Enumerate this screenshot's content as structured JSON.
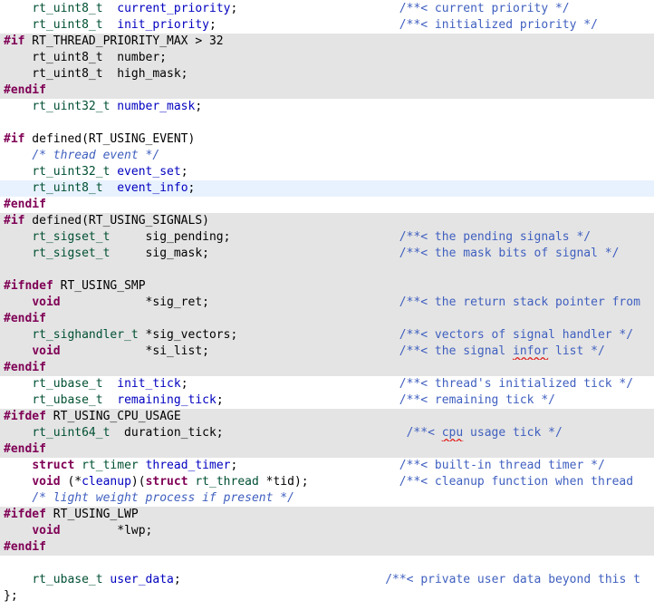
{
  "editor": {
    "language": "c",
    "colors": {
      "background": "#ffffff",
      "inactive_region": "#e4e4e4",
      "current_line": "#e8f2fe",
      "keyword": "#7f0055",
      "type": "#005032",
      "field": "#0000c0",
      "comment": "#3f5fbf",
      "spelling_mark": "#e0201e"
    },
    "lines": [
      {
        "state": "normal",
        "code": [
          [
            "    ",
            "text"
          ],
          [
            "rt_uint8_t",
            "type"
          ],
          [
            "  ",
            "text"
          ],
          [
            "current_priority",
            "id"
          ],
          [
            ";",
            "text"
          ]
        ],
        "comment": [
          [
            "/**< current priority */",
            "doc"
          ]
        ],
        "comment_col": 56
      },
      {
        "state": "normal",
        "code": [
          [
            "    ",
            "text"
          ],
          [
            "rt_uint8_t",
            "type"
          ],
          [
            "  ",
            "text"
          ],
          [
            "init_priority",
            "id"
          ],
          [
            ";",
            "text"
          ]
        ],
        "comment": [
          [
            "/**< initialized priority */",
            "doc"
          ]
        ],
        "comment_col": 56
      },
      {
        "state": "disabled",
        "code": [
          [
            "#if",
            "kw"
          ],
          [
            " RT_THREAD_PRIORITY_MAX > 32",
            "text"
          ]
        ]
      },
      {
        "state": "disabled",
        "code": [
          [
            "    rt_uint8_t  number;",
            "text"
          ]
        ]
      },
      {
        "state": "disabled",
        "code": [
          [
            "    rt_uint8_t  high_mask;",
            "text"
          ]
        ]
      },
      {
        "state": "disabled",
        "code": [
          [
            "#endif",
            "kw"
          ]
        ]
      },
      {
        "state": "normal",
        "code": [
          [
            "    ",
            "text"
          ],
          [
            "rt_uint32_t",
            "type"
          ],
          [
            " ",
            "text"
          ],
          [
            "number_mask",
            "id"
          ],
          [
            ";",
            "text"
          ]
        ]
      },
      {
        "state": "normal",
        "code": []
      },
      {
        "state": "normal",
        "code": [
          [
            "#if",
            "kw"
          ],
          [
            " defined(RT_USING_EVENT)",
            "text"
          ]
        ]
      },
      {
        "state": "normal",
        "code": [
          [
            "    ",
            "text"
          ],
          [
            "/* thread event */",
            "cmt"
          ]
        ]
      },
      {
        "state": "normal",
        "code": [
          [
            "    ",
            "text"
          ],
          [
            "rt_uint32_t",
            "type"
          ],
          [
            " ",
            "text"
          ],
          [
            "event_set",
            "id"
          ],
          [
            ";",
            "text"
          ]
        ]
      },
      {
        "state": "current",
        "code": [
          [
            "    ",
            "text"
          ],
          [
            "rt_uint8_t",
            "type"
          ],
          [
            "  ",
            "text"
          ],
          [
            "event_info",
            "id"
          ],
          [
            ";",
            "text"
          ]
        ]
      },
      {
        "state": "normal",
        "code": [
          [
            "#endif",
            "kw"
          ]
        ]
      },
      {
        "state": "disabled",
        "code": [
          [
            "#if",
            "kw"
          ],
          [
            " defined(RT_USING_SIGNALS)",
            "text"
          ]
        ]
      },
      {
        "state": "disabled",
        "code": [
          [
            "    ",
            "text"
          ],
          [
            "rt_sigset_t",
            "type"
          ],
          [
            "     sig_pending;",
            "text"
          ]
        ],
        "comment": [
          [
            "/**< the pending signals */",
            "doc"
          ]
        ],
        "comment_col": 56
      },
      {
        "state": "disabled",
        "code": [
          [
            "    ",
            "text"
          ],
          [
            "rt_sigset_t",
            "type"
          ],
          [
            "     sig_mask;",
            "text"
          ]
        ],
        "comment": [
          [
            "/**< the mask bits of signal */",
            "doc"
          ]
        ],
        "comment_col": 56
      },
      {
        "state": "disabled",
        "code": []
      },
      {
        "state": "disabled",
        "code": [
          [
            "#ifndef",
            "kw"
          ],
          [
            " RT_USING_SMP",
            "text"
          ]
        ]
      },
      {
        "state": "disabled",
        "code": [
          [
            "    ",
            "text"
          ],
          [
            "void",
            "kw"
          ],
          [
            "            *sig_ret;",
            "text"
          ]
        ],
        "comment": [
          [
            "/**< the return stack pointer from",
            "doc"
          ]
        ],
        "comment_col": 56
      },
      {
        "state": "disabled",
        "code": [
          [
            "#endif",
            "kw"
          ]
        ]
      },
      {
        "state": "disabled",
        "code": [
          [
            "    ",
            "text"
          ],
          [
            "rt_sighandler_t",
            "type"
          ],
          [
            " *sig_vectors;",
            "text"
          ]
        ],
        "comment": [
          [
            "/**< vectors of signal handler */",
            "doc"
          ]
        ],
        "comment_col": 56
      },
      {
        "state": "disabled",
        "code": [
          [
            "    ",
            "text"
          ],
          [
            "void",
            "kw"
          ],
          [
            "            *si_list;",
            "text"
          ]
        ],
        "comment": [
          [
            "/**< the signal ",
            "doc"
          ],
          [
            "infor",
            "spell"
          ],
          [
            " list */",
            "doc"
          ]
        ],
        "comment_col": 56
      },
      {
        "state": "disabled",
        "code": [
          [
            "#endif",
            "kw"
          ]
        ]
      },
      {
        "state": "normal",
        "code": [
          [
            "    ",
            "text"
          ],
          [
            "rt_ubase_t",
            "type"
          ],
          [
            "  ",
            "text"
          ],
          [
            "init_tick",
            "id"
          ],
          [
            ";",
            "text"
          ]
        ],
        "comment": [
          [
            "/**< thread's initialized tick */",
            "doc"
          ]
        ],
        "comment_col": 56
      },
      {
        "state": "normal",
        "code": [
          [
            "    ",
            "text"
          ],
          [
            "rt_ubase_t",
            "type"
          ],
          [
            "  ",
            "text"
          ],
          [
            "remaining_tick",
            "id"
          ],
          [
            ";",
            "text"
          ]
        ],
        "comment": [
          [
            "/**< remaining tick */",
            "doc"
          ]
        ],
        "comment_col": 56
      },
      {
        "state": "disabled",
        "code": [
          [
            "#ifdef",
            "kw"
          ],
          [
            " RT_USING_CPU_USAGE",
            "text"
          ]
        ]
      },
      {
        "state": "disabled",
        "code": [
          [
            "    ",
            "text"
          ],
          [
            "rt_uint64_t",
            "type"
          ],
          [
            "  duration_tick;",
            "text"
          ]
        ],
        "comment": [
          [
            "/**< ",
            "doc"
          ],
          [
            "cpu",
            "spell"
          ],
          [
            " usage tick */",
            "doc"
          ]
        ],
        "comment_col": 57
      },
      {
        "state": "disabled",
        "code": [
          [
            "#endif",
            "kw"
          ]
        ]
      },
      {
        "state": "normal",
        "code": [
          [
            "    ",
            "text"
          ],
          [
            "struct",
            "kw"
          ],
          [
            " ",
            "text"
          ],
          [
            "rt_timer",
            "type"
          ],
          [
            " ",
            "text"
          ],
          [
            "thread_timer",
            "id"
          ],
          [
            ";",
            "text"
          ]
        ],
        "comment": [
          [
            "/**< built-in thread timer */",
            "doc"
          ]
        ],
        "comment_col": 56
      },
      {
        "state": "normal",
        "code": [
          [
            "    ",
            "text"
          ],
          [
            "void",
            "kw"
          ],
          [
            " (*",
            "text"
          ],
          [
            "cleanup",
            "id"
          ],
          [
            ")(",
            "text"
          ],
          [
            "struct",
            "kw"
          ],
          [
            " ",
            "text"
          ],
          [
            "rt_thread",
            "type"
          ],
          [
            " *tid);",
            "text"
          ]
        ],
        "comment": [
          [
            "/**< cleanup function when thread",
            "doc"
          ]
        ],
        "comment_col": 56
      },
      {
        "state": "normal",
        "code": [
          [
            "    ",
            "text"
          ],
          [
            "/* light weight process if present */",
            "cmt"
          ]
        ]
      },
      {
        "state": "disabled",
        "code": [
          [
            "#ifdef",
            "kw"
          ],
          [
            " RT_USING_LWP",
            "text"
          ]
        ]
      },
      {
        "state": "disabled",
        "code": [
          [
            "    ",
            "text"
          ],
          [
            "void",
            "kw"
          ],
          [
            "        *lwp;",
            "text"
          ]
        ]
      },
      {
        "state": "disabled",
        "code": [
          [
            "#endif",
            "kw"
          ]
        ]
      },
      {
        "state": "normal",
        "code": []
      },
      {
        "state": "normal",
        "code": [
          [
            "    ",
            "text"
          ],
          [
            "rt_ubase_t",
            "type"
          ],
          [
            " ",
            "text"
          ],
          [
            "user_data",
            "id"
          ],
          [
            ";",
            "text"
          ]
        ],
        "comment": [
          [
            "/**< private user data beyond this t",
            "doc"
          ]
        ],
        "comment_col": 54
      },
      {
        "state": "normal",
        "code": [
          [
            "};",
            "text"
          ]
        ]
      }
    ]
  }
}
